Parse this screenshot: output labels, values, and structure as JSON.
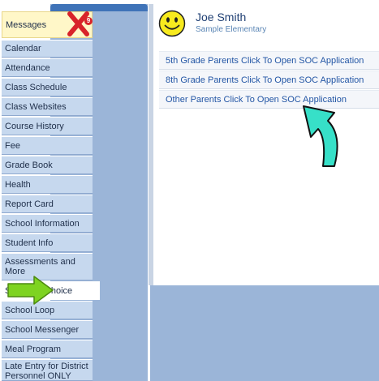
{
  "user": {
    "name": "Joe Smith",
    "school": "Sample Elementary"
  },
  "nav": {
    "items": [
      {
        "label": "Messages",
        "badge": "9"
      },
      {
        "label": "Calendar"
      },
      {
        "label": "Attendance"
      },
      {
        "label": "Class Schedule"
      },
      {
        "label": "Class Websites"
      },
      {
        "label": "Course History"
      },
      {
        "label": "Fee"
      },
      {
        "label": "Grade Book"
      },
      {
        "label": "Health"
      },
      {
        "label": "Report Card"
      },
      {
        "label": "School Information"
      },
      {
        "label": "Student Info"
      },
      {
        "label": "Assessments and More"
      },
      {
        "label": "School of Choice"
      },
      {
        "label": "School Loop"
      },
      {
        "label": "School Messenger"
      },
      {
        "label": "Meal Program"
      },
      {
        "label": "Late Entry for District Personnel ONLY"
      }
    ],
    "active_index": 13
  },
  "soc_links": [
    "5th Grade Parents Click To Open SOC Application",
    "8th Grade Parents Click To Open SOC Application",
    "Other Parents Click To Open SOC Application"
  ],
  "colors": {
    "sidebar": "#9bb5d8",
    "nav_item": "#c6d8ee",
    "link_text": "#2356a5",
    "green_arrow": "#7ed321",
    "cyan_arrow": "#37e0c8",
    "red_x": "#d8232a"
  },
  "icons": [
    "smiley-avatar-icon",
    "red-x-mark-icon",
    "green-arrow-icon",
    "cyan-arrow-icon"
  ]
}
